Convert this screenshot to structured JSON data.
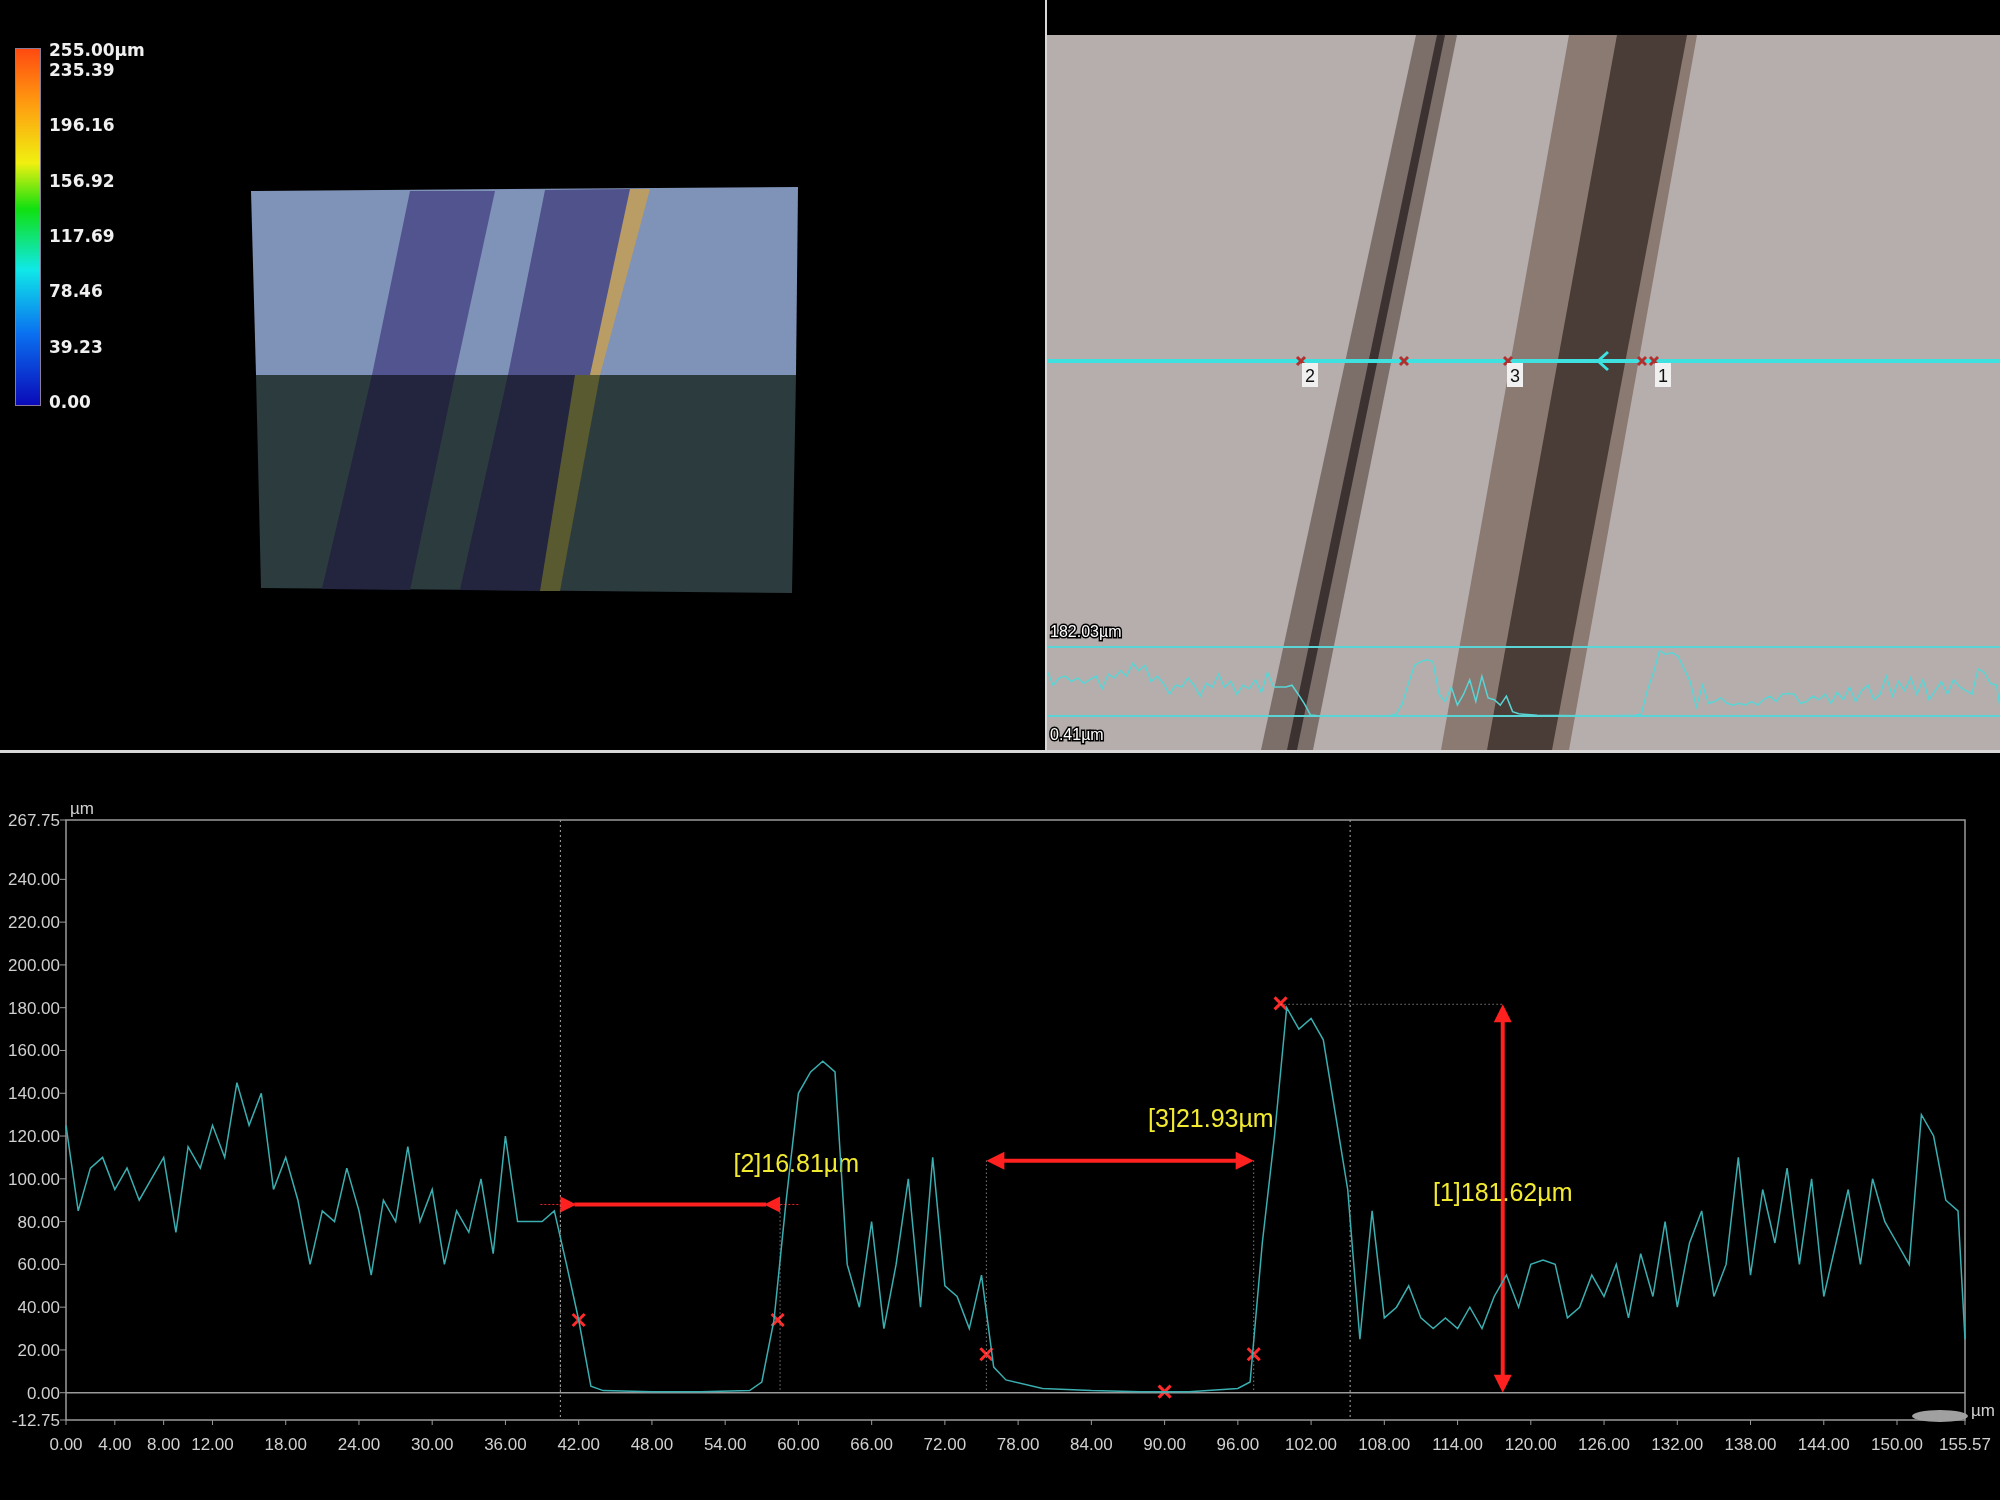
{
  "legend": {
    "max_label": "255.00µm",
    "labels": [
      "235.39",
      "196.16",
      "156.92",
      "117.69",
      "78.46",
      "39.23",
      "0.00"
    ]
  },
  "camera_view": {
    "point_labels": [
      "2",
      "3",
      "1"
    ],
    "mini_profile": {
      "max_label": "182.03µm",
      "min_label": "0.41µm"
    }
  },
  "profile_chart": {
    "chart_data": {
      "type": "line",
      "xlabel": "µm",
      "ylabel": "µm",
      "xlim": [
        0,
        155.57
      ],
      "ylim": [
        -12.75,
        267.75
      ],
      "x": [
        0,
        1,
        2,
        3,
        4,
        5,
        6,
        7,
        8,
        9,
        10,
        11,
        12,
        13,
        14,
        15,
        16,
        17,
        18,
        19,
        20,
        21,
        22,
        23,
        24,
        25,
        26,
        27,
        28,
        29,
        30,
        31,
        32,
        33,
        34,
        35,
        36,
        37,
        38,
        39,
        40,
        41,
        42,
        43,
        44,
        48,
        52,
        56,
        57,
        58,
        59,
        60,
        61,
        62,
        63,
        64,
        65,
        66,
        67,
        68,
        69,
        70,
        71,
        72,
        73,
        74,
        75,
        76,
        77,
        80,
        84,
        88,
        92,
        96,
        97,
        98,
        99,
        100,
        101,
        102,
        103,
        104,
        105,
        106,
        107,
        108,
        109,
        110,
        111,
        112,
        113,
        114,
        115,
        116,
        117,
        118,
        119,
        120,
        121,
        122,
        123,
        124,
        125,
        126,
        127,
        128,
        129,
        130,
        131,
        132,
        133,
        134,
        135,
        136,
        137,
        138,
        139,
        140,
        141,
        142,
        143,
        144,
        145,
        146,
        147,
        148,
        149,
        150,
        151,
        152,
        153,
        154,
        155,
        155.57
      ],
      "series": [
        {
          "color": "#3aaeb0",
          "values": [
            125,
            85,
            105,
            110,
            95,
            105,
            90,
            100,
            110,
            75,
            115,
            105,
            125,
            110,
            145,
            125,
            140,
            95,
            110,
            90,
            60,
            85,
            80,
            105,
            85,
            55,
            90,
            80,
            115,
            80,
            95,
            60,
            85,
            75,
            100,
            65,
            120,
            80,
            80,
            80,
            85,
            60,
            34,
            3,
            1,
            0.5,
            0.5,
            1,
            5,
            34,
            90,
            140,
            150,
            155,
            150,
            60,
            40,
            80,
            30,
            60,
            100,
            40,
            110,
            50,
            45,
            30,
            55,
            12,
            6,
            2,
            1,
            0.5,
            0.5,
            2,
            5,
            70,
            120,
            180,
            170,
            175,
            165,
            130,
            95,
            25,
            85,
            35,
            40,
            50,
            35,
            30,
            35,
            30,
            40,
            30,
            45,
            55,
            40,
            60,
            62,
            60,
            35,
            40,
            55,
            45,
            60,
            35,
            65,
            45,
            80,
            40,
            70,
            85,
            45,
            60,
            110,
            55,
            95,
            70,
            105,
            60,
            100,
            45,
            70,
            95,
            60,
            100,
            80,
            70,
            60,
            130,
            120,
            90,
            85,
            25
          ]
        }
      ],
      "xticks": [
        {
          "value": 0,
          "label": "0.00"
        },
        {
          "value": 4,
          "label": "4.00"
        },
        {
          "value": 8,
          "label": "8.00"
        },
        {
          "value": 12,
          "label": "12.00"
        },
        {
          "value": 18,
          "label": "18.00"
        },
        {
          "value": 24,
          "label": "24.00"
        },
        {
          "value": 30,
          "label": "30.00"
        },
        {
          "value": 36,
          "label": "36.00"
        },
        {
          "value": 42,
          "label": "42.00"
        },
        {
          "value": 48,
          "label": "48.00"
        },
        {
          "value": 54,
          "label": "54.00"
        },
        {
          "value": 60,
          "label": "60.00"
        },
        {
          "value": 66,
          "label": "66.00"
        },
        {
          "value": 72,
          "label": "72.00"
        },
        {
          "value": 78,
          "label": "78.00"
        },
        {
          "value": 84,
          "label": "84.00"
        },
        {
          "value": 90,
          "label": "90.00"
        },
        {
          "value": 96,
          "label": "96.00"
        },
        {
          "value": 102,
          "label": "102.00"
        },
        {
          "value": 108,
          "label": "108.00"
        },
        {
          "value": 114,
          "label": "114.00"
        },
        {
          "value": 120,
          "label": "120.00"
        },
        {
          "value": 126,
          "label": "126.00"
        },
        {
          "value": 132,
          "label": "132.00"
        },
        {
          "value": 138,
          "label": "138.00"
        },
        {
          "value": 144,
          "label": "144.00"
        },
        {
          "value": 150,
          "label": "150.00"
        },
        {
          "value": 155.57,
          "label": "155.57"
        }
      ],
      "yticks": [
        {
          "value": -12.75,
          "label": "-12.75"
        },
        {
          "value": 0,
          "label": "0.00"
        },
        {
          "value": 20,
          "label": "20.00"
        },
        {
          "value": 40,
          "label": "40.00"
        },
        {
          "value": 60,
          "label": "60.00"
        },
        {
          "value": 80,
          "label": "80.00"
        },
        {
          "value": 100,
          "label": "100.00"
        },
        {
          "value": 120,
          "label": "120.00"
        },
        {
          "value": 140,
          "label": "140.00"
        },
        {
          "value": 160,
          "label": "160.00"
        },
        {
          "value": 180,
          "label": "180.00"
        },
        {
          "value": 200,
          "label": "200.00"
        },
        {
          "value": 220,
          "label": "220.00"
        },
        {
          "value": 240,
          "label": "240.00"
        },
        {
          "value": 267.75,
          "label": "267.75"
        }
      ]
    },
    "measurements": [
      {
        "kind": "width",
        "label": "[2]16.81µm"
      },
      {
        "kind": "width",
        "label": "[3]21.93µm"
      },
      {
        "kind": "height",
        "label": "[1]181.62µm"
      }
    ]
  }
}
